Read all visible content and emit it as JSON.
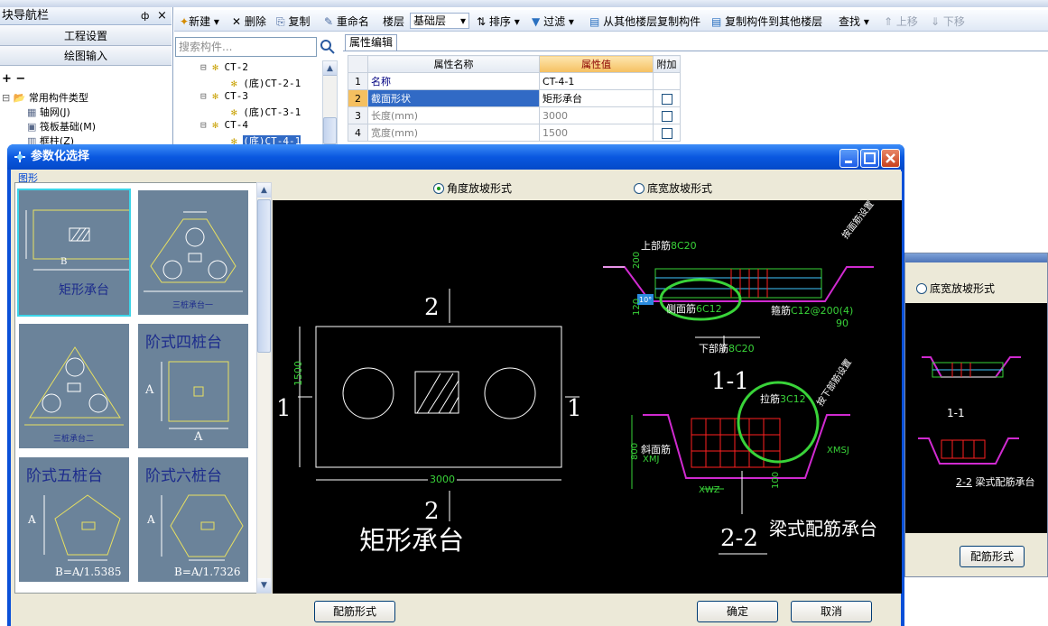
{
  "nav": {
    "title": "块导航栏",
    "pin": "ф",
    "close": "×",
    "buttons": [
      "工程设置",
      "绘图输入"
    ],
    "tree_title": "常用构件类型",
    "tree_items": [
      "轴网(J)",
      "筏板基础(M)",
      "框柱(Z)"
    ]
  },
  "search": {
    "placeholder": "搜索构件..."
  },
  "component_tree": [
    {
      "label": "CT-2",
      "child": "(底)CT-2-1"
    },
    {
      "label": "CT-3",
      "child": "(底)CT-3-1"
    },
    {
      "label": "CT-4",
      "child": "(底)CT-4-1"
    }
  ],
  "toolbar": {
    "new": "新建",
    "delete": "删除",
    "copy": "复制",
    "rename": "重命名",
    "floor_label": "楼层",
    "floor_value": "基础层",
    "sort": "排序",
    "filter": "过滤",
    "copy_from": "从其他楼层复制构件",
    "copy_to": "复制构件到其他楼层",
    "find": "查找",
    "move_up": "上移",
    "move_down": "下移"
  },
  "props": {
    "tab": "属性编辑",
    "headers": [
      "属性名称",
      "属性值",
      "附加"
    ],
    "rows": [
      {
        "idx": "1",
        "name": "名称",
        "value": "CT-4-1"
      },
      {
        "idx": "2",
        "name": "截面形状",
        "value": "矩形承台"
      },
      {
        "idx": "3",
        "name": "长度(mm)",
        "value": "3000"
      },
      {
        "idx": "4",
        "name": "宽度(mm)",
        "value": "1500"
      }
    ]
  },
  "dialog": {
    "title": "参数化选择",
    "group_label": "图形",
    "shapes": [
      {
        "caption": "矩形承台",
        "dim": "B"
      },
      {
        "caption": "三桩承台一"
      },
      {
        "caption": "三桩承台二"
      },
      {
        "caption": "阶式四桩台",
        "dim": "A"
      },
      {
        "caption": "阶式五桩台",
        "dim": "A",
        "formula": "B=A/1.5385"
      },
      {
        "caption": "阶式六桩台",
        "dim": "A",
        "formula": "B=A/1.7326"
      }
    ],
    "radio_angle": "角度放坡形式",
    "radio_width": "底宽放坡形式",
    "rebar_button": "配筋形式",
    "ok_button": "确定",
    "cancel_button": "取消"
  },
  "drawing": {
    "plan_title": "矩形承台",
    "section_mark": "2",
    "side_mark": "1",
    "width_dim": "3000",
    "height_dim": "1500",
    "top_rebar": "上部筋",
    "top_rebar_val": "8C20",
    "side_rebar": "侧面筋",
    "side_rebar_val": "6C12",
    "hoop": "箍筋",
    "hoop_val": "C12@200(4)",
    "bottom_rebar": "下部筋",
    "bottom_rebar_val": "8C20",
    "angle_val": "90",
    "angle_small": "10°",
    "tie_rebar": "拉筋",
    "tie_rebar_val": "3C12",
    "slope_rebar": "斜面筋",
    "xmj": "XMJ",
    "xmsj": "XMSJ",
    "xwz": "XWZ",
    "slope_note": "按下部筋设置",
    "slope_note2": "按面筋设置",
    "dim_200": "200",
    "dim_120": "120",
    "dim_800": "800",
    "dim_100": "100",
    "section_1": "1-1",
    "section_2": "2-2",
    "beam_title": "梁式配筋承台"
  },
  "bgwin": {
    "radio_width": "底宽放坡形式",
    "rebar_button": "配筋形式",
    "section_1": "1-1",
    "section_2": "2-2",
    "beam_title": "梁式配筋承台"
  },
  "colors": {
    "accent": "#0a58e0",
    "selected_row": "#316ac5",
    "value_header": "#f9c870",
    "green": "#39d339",
    "magenta": "#d02ad0",
    "red": "#ff2020"
  }
}
